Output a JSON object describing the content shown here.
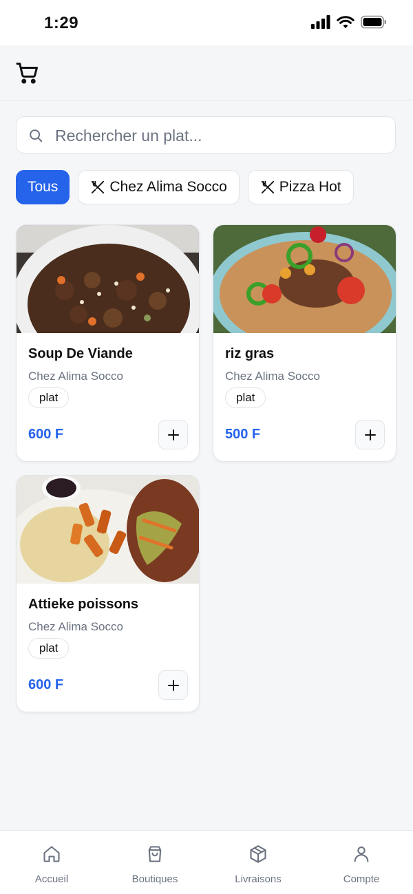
{
  "status_bar": {
    "time": "1:29"
  },
  "header": {
    "cart_icon": "cart-icon"
  },
  "search": {
    "placeholder": "Rechercher un plat...",
    "icon": "search-icon"
  },
  "filters": [
    {
      "label": "Tous",
      "active": true
    },
    {
      "label": "Chez Alima Socco",
      "icon": "utensils-crossed-icon",
      "active": false
    },
    {
      "label": "Pizza Hot",
      "icon": "utensils-crossed-icon",
      "active": false
    }
  ],
  "products": [
    {
      "name": "Soup De Viande",
      "shop": "Chez Alima Socco",
      "tag": "plat",
      "price": "600 F"
    },
    {
      "name": "riz gras",
      "shop": "Chez Alima Socco",
      "tag": "plat",
      "price": "500 F"
    },
    {
      "name": "Attieke poissons",
      "shop": "Chez Alima Socco",
      "tag": "plat",
      "price": "600 F"
    }
  ],
  "bottom_nav": [
    {
      "label": "Accueil",
      "icon": "home-icon"
    },
    {
      "label": "Boutiques",
      "icon": "shopping-bag-icon"
    },
    {
      "label": "Livraisons",
      "icon": "package-icon"
    },
    {
      "label": "Compte",
      "icon": "user-icon"
    }
  ],
  "colors": {
    "accent": "#2563eb",
    "background": "#f5f6f8",
    "muted_text": "#6b7280"
  }
}
